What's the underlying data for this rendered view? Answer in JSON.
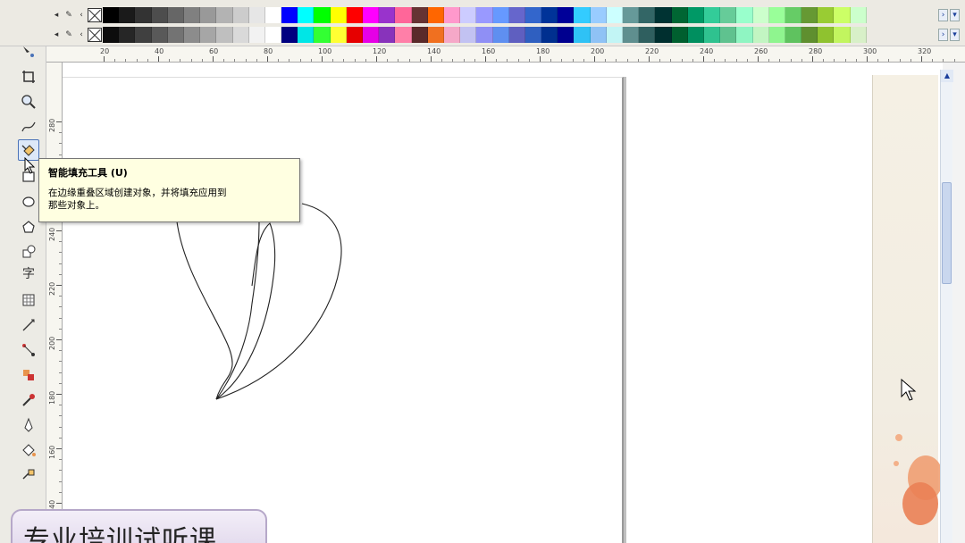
{
  "palette": {
    "row1_colors": [
      "#000000",
      "#1a1a1a",
      "#333333",
      "#4d4d4d",
      "#666666",
      "#808080",
      "#999999",
      "#b3b3b3",
      "#cccccc",
      "#e6e6e6",
      "#ffffff",
      "#0000ff",
      "#00ffff",
      "#00ff00",
      "#ffff00",
      "#ff0000",
      "#ff00ff",
      "#9933cc",
      "#ff6699",
      "#663333",
      "#ff6600",
      "#ff99cc",
      "#ccccff",
      "#9999ff",
      "#6699ff",
      "#6666cc",
      "#3366cc",
      "#003399",
      "#000099",
      "#33ccff",
      "#99ccff",
      "#ccffff",
      "#669999",
      "#336666",
      "#003333",
      "#006633",
      "#009966",
      "#33cc99",
      "#66cc99",
      "#99ffcc",
      "#ccffcc",
      "#99ff99",
      "#66cc66",
      "#669933",
      "#99cc33",
      "#ccff66",
      "#ccffcc"
    ],
    "row2_colors": [
      "#0d0d0d",
      "#262626",
      "#404040",
      "#595959",
      "#737373",
      "#8c8c8c",
      "#a6a6a6",
      "#bfbfbf",
      "#d9d9d9",
      "#f2f2f2",
      "#ffffff",
      "#000080",
      "#00e6e6",
      "#33ff33",
      "#ffff33",
      "#e60000",
      "#e600e6",
      "#8833bb",
      "#ff7fa8",
      "#5a2a2a",
      "#f07020",
      "#f5a8c8",
      "#c2c2f2",
      "#8f8ff5",
      "#5f8ff0",
      "#5f5fc0",
      "#2f5fc0",
      "#002f8f",
      "#00008f",
      "#2fc2f5",
      "#8fc2f5",
      "#c2f5f5",
      "#5f8f8f",
      "#2f5f5f",
      "#002f2f",
      "#005f2f",
      "#008f5f",
      "#2fc28f",
      "#5fc28f",
      "#8ff5c2",
      "#c2f5c2",
      "#8ff58f",
      "#5fc25f",
      "#5f8f2f",
      "#8fc22f",
      "#c2f55f",
      "#d8f0c8"
    ]
  },
  "ruler": {
    "h_labels": [
      "20",
      "40",
      "60",
      "80",
      "100",
      "120",
      "140",
      "160",
      "180",
      "200",
      "220",
      "240",
      "260",
      "280",
      "300",
      "320"
    ],
    "v_labels": [
      "280",
      "260",
      "240",
      "220",
      "200",
      "180",
      "160",
      "140"
    ]
  },
  "tooltip": {
    "title": "智能填充工具 (U)",
    "body_line1": "在边缘重叠区域创建对象，并将填充应用到",
    "body_line2": "那些对象上。"
  },
  "toolbox": {
    "text_tool_char": "字"
  },
  "banner": {
    "text": "专业培训试听课"
  },
  "colors": {
    "tooltip_bg": "#ffffe1",
    "banner_border": "#b6a8c9",
    "docker_accent": "#ea8155"
  }
}
